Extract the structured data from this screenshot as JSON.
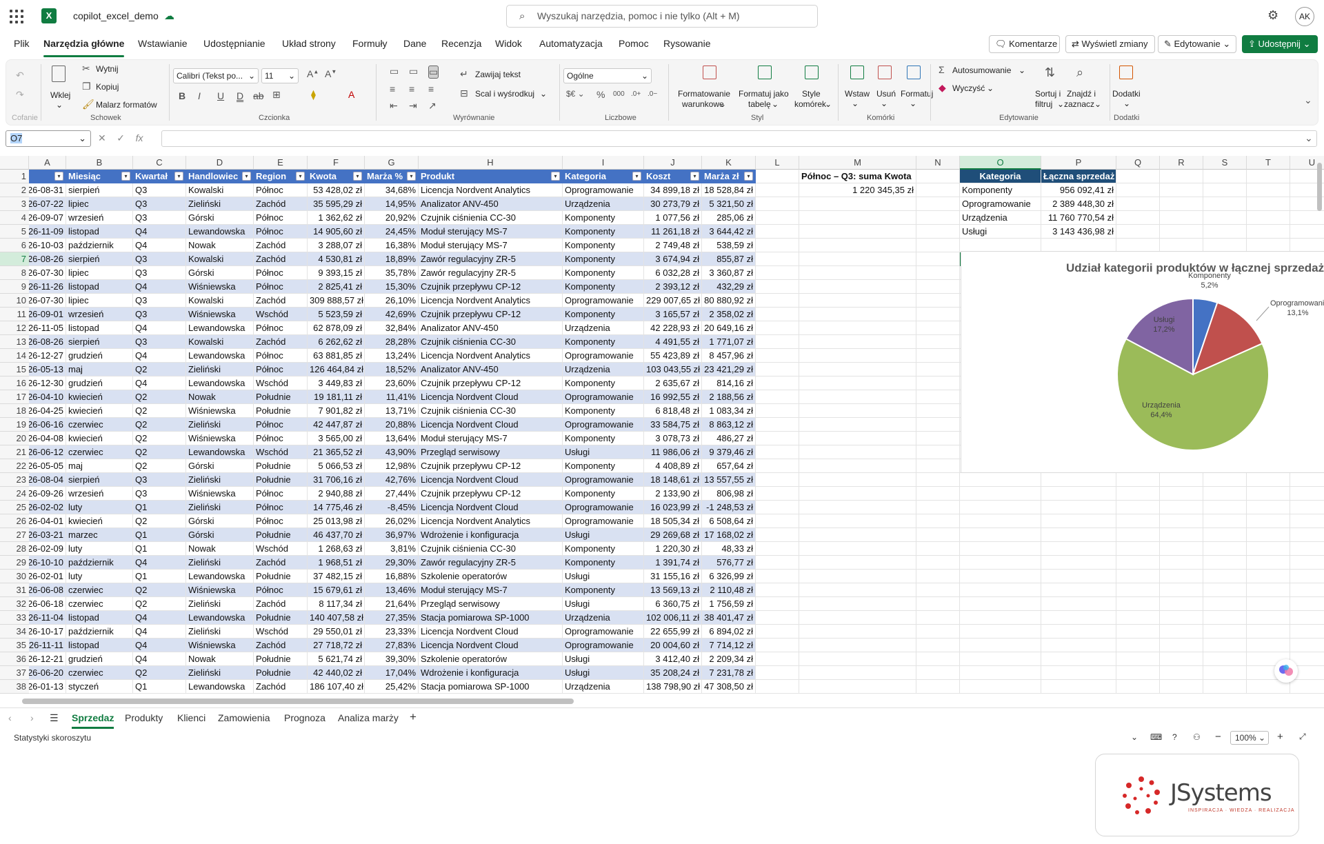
{
  "app": {
    "doc_title": "copilot_excel_demo",
    "search_placeholder": "Wyszukaj narzędzia, pomoc i nie tylko (Alt + M)",
    "avatar": "AK",
    "logo_letter": "X"
  },
  "menu": [
    "Plik",
    "Narzędzia główne",
    "Wstawianie",
    "Udostępnianie",
    "Układ strony",
    "Formuły",
    "Dane",
    "Recenzja",
    "Widok",
    "Automatyzacja",
    "Pomoc",
    "Rysowanie"
  ],
  "top_buttons": {
    "comments": "Komentarze",
    "changes": "Wyświetl zmiany",
    "editing": "Edytowanie",
    "share": "Udostępnij"
  },
  "ribbon": {
    "groups": {
      "undo": "Cofanie",
      "clipboard": "Schowek",
      "font": "Czcionka",
      "align": "Wyrównanie",
      "number": "Liczbowe",
      "style": "Styl",
      "cells": "Komórki",
      "edit": "Edytowanie",
      "addins": "Dodatki"
    },
    "paste": "Wklej",
    "cut": "Wytnij",
    "copy": "Kopiuj",
    "painter": "Malarz formatów",
    "font_name": "Calibri (Tekst po...",
    "font_size": "11",
    "wrap": "Zawijaj tekst",
    "merge": "Scal i wyśrodkuj",
    "number_format": "Ogólne",
    "cond1": "Formatowanie",
    "cond2": "warunkowe",
    "tbl1": "Formatuj jako",
    "tbl2": "tabelę",
    "sty1": "Style",
    "sty2": "komórek",
    "insert": "Wstaw",
    "delete": "Usuń",
    "format": "Formatuj",
    "autosum": "Autosumowanie",
    "clear": "Wyczyść",
    "sort1": "Sortuj i",
    "sort2": "filtruj",
    "find1": "Znajdź i",
    "find2": "zaznacz",
    "addins": "Dodatki"
  },
  "name_box": "O7",
  "columns": [
    "A",
    "B",
    "C",
    "D",
    "E",
    "F",
    "G",
    "H",
    "I",
    "J",
    "K",
    "L",
    "M",
    "N",
    "O",
    "P",
    "Q",
    "R",
    "S",
    "T",
    "U"
  ],
  "table": {
    "headers": [
      "",
      "Miesiąc",
      "Kwartał",
      "Handlowiec",
      "Region",
      "Kwota",
      "Marża %",
      "Produkt",
      "Kategoria",
      "Koszt",
      "Marża zł"
    ],
    "rows": [
      [
        "26-08-31",
        "sierpień",
        "Q3",
        "Kowalski",
        "Północ",
        "53 428,02 zł",
        "34,68%",
        "Licencja Nordvent Analytics",
        "Oprogramowanie",
        "34 899,18 zł",
        "18 528,84 zł"
      ],
      [
        "26-07-22",
        "lipiec",
        "Q3",
        "Zieliński",
        "Zachód",
        "35 595,29 zł",
        "14,95%",
        "Analizator ANV-450",
        "Urządzenia",
        "30 273,79 zł",
        "5 321,50 zł"
      ],
      [
        "26-09-07",
        "wrzesień",
        "Q3",
        "Górski",
        "Północ",
        "1 362,62 zł",
        "20,92%",
        "Czujnik ciśnienia CC-30",
        "Komponenty",
        "1 077,56 zł",
        "285,06 zł"
      ],
      [
        "26-11-09",
        "listopad",
        "Q4",
        "Lewandowska",
        "Północ",
        "14 905,60 zł",
        "24,45%",
        "Moduł sterujący MS-7",
        "Komponenty",
        "11 261,18 zł",
        "3 644,42 zł"
      ],
      [
        "26-10-03",
        "październik",
        "Q4",
        "Nowak",
        "Zachód",
        "3 288,07 zł",
        "16,38%",
        "Moduł sterujący MS-7",
        "Komponenty",
        "2 749,48 zł",
        "538,59 zł"
      ],
      [
        "26-08-26",
        "sierpień",
        "Q3",
        "Kowalski",
        "Zachód",
        "4 530,81 zł",
        "18,89%",
        "Zawór regulacyjny ZR-5",
        "Komponenty",
        "3 674,94 zł",
        "855,87 zł"
      ],
      [
        "26-07-30",
        "lipiec",
        "Q3",
        "Górski",
        "Północ",
        "9 393,15 zł",
        "35,78%",
        "Zawór regulacyjny ZR-5",
        "Komponenty",
        "6 032,28 zł",
        "3 360,87 zł"
      ],
      [
        "26-11-26",
        "listopad",
        "Q4",
        "Wiśniewska",
        "Północ",
        "2 825,41 zł",
        "15,30%",
        "Czujnik przepływu CP-12",
        "Komponenty",
        "2 393,12 zł",
        "432,29 zł"
      ],
      [
        "26-07-30",
        "lipiec",
        "Q3",
        "Kowalski",
        "Zachód",
        "309 888,57 zł",
        "26,10%",
        "Licencja Nordvent Analytics",
        "Oprogramowanie",
        "229 007,65 zł",
        "80 880,92 zł"
      ],
      [
        "26-09-01",
        "wrzesień",
        "Q3",
        "Wiśniewska",
        "Wschód",
        "5 523,59 zł",
        "42,69%",
        "Czujnik przepływu CP-12",
        "Komponenty",
        "3 165,57 zł",
        "2 358,02 zł"
      ],
      [
        "26-11-05",
        "listopad",
        "Q4",
        "Lewandowska",
        "Północ",
        "62 878,09 zł",
        "32,84%",
        "Analizator ANV-450",
        "Urządzenia",
        "42 228,93 zł",
        "20 649,16 zł"
      ],
      [
        "26-08-26",
        "sierpień",
        "Q3",
        "Kowalski",
        "Zachód",
        "6 262,62 zł",
        "28,28%",
        "Czujnik ciśnienia CC-30",
        "Komponenty",
        "4 491,55 zł",
        "1 771,07 zł"
      ],
      [
        "26-12-27",
        "grudzień",
        "Q4",
        "Lewandowska",
        "Północ",
        "63 881,85 zł",
        "13,24%",
        "Licencja Nordvent Analytics",
        "Oprogramowanie",
        "55 423,89 zł",
        "8 457,96 zł"
      ],
      [
        "26-05-13",
        "maj",
        "Q2",
        "Zieliński",
        "Północ",
        "126 464,84 zł",
        "18,52%",
        "Analizator ANV-450",
        "Urządzenia",
        "103 043,55 zł",
        "23 421,29 zł"
      ],
      [
        "26-12-30",
        "grudzień",
        "Q4",
        "Lewandowska",
        "Wschód",
        "3 449,83 zł",
        "23,60%",
        "Czujnik przepływu CP-12",
        "Komponenty",
        "2 635,67 zł",
        "814,16 zł"
      ],
      [
        "26-04-10",
        "kwiecień",
        "Q2",
        "Nowak",
        "Południe",
        "19 181,11 zł",
        "11,41%",
        "Licencja Nordvent Cloud",
        "Oprogramowanie",
        "16 992,55 zł",
        "2 188,56 zł"
      ],
      [
        "26-04-25",
        "kwiecień",
        "Q2",
        "Wiśniewska",
        "Południe",
        "7 901,82 zł",
        "13,71%",
        "Czujnik ciśnienia CC-30",
        "Komponenty",
        "6 818,48 zł",
        "1 083,34 zł"
      ],
      [
        "26-06-16",
        "czerwiec",
        "Q2",
        "Zieliński",
        "Północ",
        "42 447,87 zł",
        "20,88%",
        "Licencja Nordvent Cloud",
        "Oprogramowanie",
        "33 584,75 zł",
        "8 863,12 zł"
      ],
      [
        "26-04-08",
        "kwiecień",
        "Q2",
        "Wiśniewska",
        "Północ",
        "3 565,00 zł",
        "13,64%",
        "Moduł sterujący MS-7",
        "Komponenty",
        "3 078,73 zł",
        "486,27 zł"
      ],
      [
        "26-06-12",
        "czerwiec",
        "Q2",
        "Lewandowska",
        "Wschód",
        "21 365,52 zł",
        "43,90%",
        "Przegląd serwisowy",
        "Usługi",
        "11 986,06 zł",
        "9 379,46 zł"
      ],
      [
        "26-05-05",
        "maj",
        "Q2",
        "Górski",
        "Południe",
        "5 066,53 zł",
        "12,98%",
        "Czujnik przepływu CP-12",
        "Komponenty",
        "4 408,89 zł",
        "657,64 zł"
      ],
      [
        "26-08-04",
        "sierpień",
        "Q3",
        "Zieliński",
        "Południe",
        "31 706,16 zł",
        "42,76%",
        "Licencja Nordvent Cloud",
        "Oprogramowanie",
        "18 148,61 zł",
        "13 557,55 zł"
      ],
      [
        "26-09-26",
        "wrzesień",
        "Q3",
        "Wiśniewska",
        "Północ",
        "2 940,88 zł",
        "27,44%",
        "Czujnik przepływu CP-12",
        "Komponenty",
        "2 133,90 zł",
        "806,98 zł"
      ],
      [
        "26-02-02",
        "luty",
        "Q1",
        "Zieliński",
        "Północ",
        "14 775,46 zł",
        "-8,45%",
        "Licencja Nordvent Cloud",
        "Oprogramowanie",
        "16 023,99 zł",
        "-1 248,53 zł"
      ],
      [
        "26-04-01",
        "kwiecień",
        "Q2",
        "Górski",
        "Północ",
        "25 013,98 zł",
        "26,02%",
        "Licencja Nordvent Analytics",
        "Oprogramowanie",
        "18 505,34 zł",
        "6 508,64 zł"
      ],
      [
        "26-03-21",
        "marzec",
        "Q1",
        "Górski",
        "Południe",
        "46 437,70 zł",
        "36,97%",
        "Wdrożenie i konfiguracja",
        "Usługi",
        "29 269,68 zł",
        "17 168,02 zł"
      ],
      [
        "26-02-09",
        "luty",
        "Q1",
        "Nowak",
        "Wschód",
        "1 268,63 zł",
        "3,81%",
        "Czujnik ciśnienia CC-30",
        "Komponenty",
        "1 220,30 zł",
        "48,33 zł"
      ],
      [
        "26-10-10",
        "październik",
        "Q4",
        "Zieliński",
        "Zachód",
        "1 968,51 zł",
        "29,30%",
        "Zawór regulacyjny ZR-5",
        "Komponenty",
        "1 391,74 zł",
        "576,77 zł"
      ],
      [
        "26-02-01",
        "luty",
        "Q1",
        "Lewandowska",
        "Południe",
        "37 482,15 zł",
        "16,88%",
        "Szkolenie operatorów",
        "Usługi",
        "31 155,16 zł",
        "6 326,99 zł"
      ],
      [
        "26-06-08",
        "czerwiec",
        "Q2",
        "Wiśniewska",
        "Północ",
        "15 679,61 zł",
        "13,46%",
        "Moduł sterujący MS-7",
        "Komponenty",
        "13 569,13 zł",
        "2 110,48 zł"
      ],
      [
        "26-06-18",
        "czerwiec",
        "Q2",
        "Zieliński",
        "Zachód",
        "8 117,34 zł",
        "21,64%",
        "Przegląd serwisowy",
        "Usługi",
        "6 360,75 zł",
        "1 756,59 zł"
      ],
      [
        "26-11-04",
        "listopad",
        "Q4",
        "Lewandowska",
        "Południe",
        "140 407,58 zł",
        "27,35%",
        "Stacja pomiarowa SP-1000",
        "Urządzenia",
        "102 006,11 zł",
        "38 401,47 zł"
      ],
      [
        "26-10-17",
        "październik",
        "Q4",
        "Zieliński",
        "Wschód",
        "29 550,01 zł",
        "23,33%",
        "Licencja Nordvent Cloud",
        "Oprogramowanie",
        "22 655,99 zł",
        "6 894,02 zł"
      ],
      [
        "26-11-11",
        "listopad",
        "Q4",
        "Wiśniewska",
        "Zachód",
        "27 718,72 zł",
        "27,83%",
        "Licencja Nordvent Cloud",
        "Oprogramowanie",
        "20 004,60 zł",
        "7 714,12 zł"
      ],
      [
        "26-12-21",
        "grudzień",
        "Q4",
        "Nowak",
        "Południe",
        "5 621,74 zł",
        "39,30%",
        "Szkolenie operatorów",
        "Usługi",
        "3 412,40 zł",
        "2 209,34 zł"
      ],
      [
        "26-06-20",
        "czerwiec",
        "Q2",
        "Zieliński",
        "Południe",
        "42 440,02 zł",
        "17,04%",
        "Wdrożenie i konfiguracja",
        "Usługi",
        "35 208,24 zł",
        "7 231,78 zł"
      ],
      [
        "26-01-13",
        "styczeń",
        "Q1",
        "Lewandowska",
        "Zachód",
        "186 107,40 zł",
        "25,42%",
        "Stacja pomiarowa SP-1000",
        "Urządzenia",
        "138 798,90 zł",
        "47 308,50 zł"
      ]
    ]
  },
  "summary": {
    "label": "Północ – Q3: suma Kwota",
    "value": "1 220 345,35 zł"
  },
  "summary_table": {
    "headers": [
      "Kategoria",
      "Łączna sprzedaż"
    ],
    "rows": [
      [
        "Komponenty",
        "956 092,41 zł"
      ],
      [
        "Oprogramowanie",
        "2 389 448,30 zł"
      ],
      [
        "Urządzenia",
        "11 760 770,54 zł"
      ],
      [
        "Usługi",
        "3 143 436,98 zł"
      ]
    ]
  },
  "chart_data": {
    "type": "pie",
    "title": "Udział kategorii produktów w łącznej sprzedaży",
    "categories": [
      "Komponenty",
      "Oprogramowanie",
      "Urządzenia",
      "Usługi"
    ],
    "values": [
      5.2,
      13.1,
      64.4,
      17.2
    ],
    "labels": [
      "5,2%",
      "13,1%",
      "64,4%",
      "17,2%"
    ],
    "colors": [
      "#4472c4",
      "#c0504d",
      "#9bbb59",
      "#8064a2"
    ]
  },
  "sheets": [
    "Sprzedaz",
    "Produkty",
    "Klienci",
    "Zamowienia",
    "Prognoza",
    "Analiza marży"
  ],
  "status": {
    "left": "Statystyki skoroszytu",
    "zoom": "100%"
  },
  "brand": {
    "name": "JSystems",
    "tagline": "INSPIRACJA · WIEDZA · REALIZACJA"
  }
}
